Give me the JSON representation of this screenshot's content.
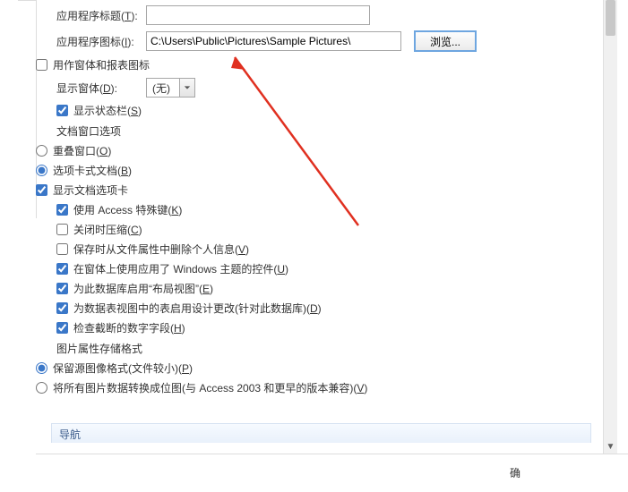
{
  "form": {
    "appTitle": {
      "label": "应用程序标题(",
      "accel": "T",
      "labelEnd": "):",
      "value": ""
    },
    "appIcon": {
      "label": "应用程序图标(",
      "accel": "I",
      "labelEnd": "):",
      "value": "C:\\Users\\Public\\Pictures\\Sample Pictures\\"
    },
    "browse": "浏览...",
    "useAsIcon": {
      "label": "用作窗体和报表图标",
      "checked": false
    },
    "showForm": {
      "label": "显示窗体(",
      "accel": "D",
      "labelEnd": "):",
      "value": "(无)"
    },
    "statusBar": {
      "label": "显示状态栏(",
      "accel": "S",
      "labelEnd": ")",
      "checked": true
    },
    "docWinHeader": "文档窗口选项",
    "docWin": {
      "overlap": {
        "label": "重叠窗口(",
        "accel": "O",
        "labelEnd": ")",
        "checked": false
      },
      "tabbed": {
        "label": "选项卡式文档(",
        "accel": "B",
        "labelEnd": ")",
        "checked": true
      },
      "showTabs": {
        "label": "显示文档选项卡",
        "checked": true
      }
    },
    "useAccessKeys": {
      "label": "使用 Access 特殊键(",
      "accel": "K",
      "labelEnd": ")",
      "checked": true
    },
    "compactClose": {
      "label": "关闭时压缩(",
      "accel": "C",
      "labelEnd": ")",
      "checked": false
    },
    "removePI": {
      "label": "保存时从文件属性中删除个人信息(",
      "accel": "V",
      "labelEnd": ")",
      "checked": false
    },
    "themedCtrls": {
      "label": "在窗体上使用应用了 Windows 主题的控件(",
      "accel": "U",
      "labelEnd": ")",
      "checked": true
    },
    "layoutView": {
      "label1": "为此数据库启用",
      "label2": "“布局视图”",
      "label3": "(",
      "accel": "E",
      "labelEnd": ")",
      "checked": true
    },
    "designChanges": {
      "label": "为数据表视图中的表启用设计更改(针对此数据库)(",
      "accel": "D",
      "labelEnd": ")",
      "checked": true
    },
    "truncNum": {
      "label": "检查截断的数字字段(",
      "accel": "H",
      "labelEnd": ")",
      "checked": true
    },
    "picHeader": "图片属性存储格式",
    "pic": {
      "preserve": {
        "label": "保留源图像格式(文件较小)(",
        "accel": "P",
        "labelEnd": ")",
        "checked": true
      },
      "convert": {
        "label": "将所有图片数据转换成位图(与 Access 2003 和更早的版本兼容)(",
        "accel": "V",
        "labelEnd": ")",
        "checked": false
      }
    }
  },
  "navHeader": "导航",
  "footerButtonPartial": "确"
}
